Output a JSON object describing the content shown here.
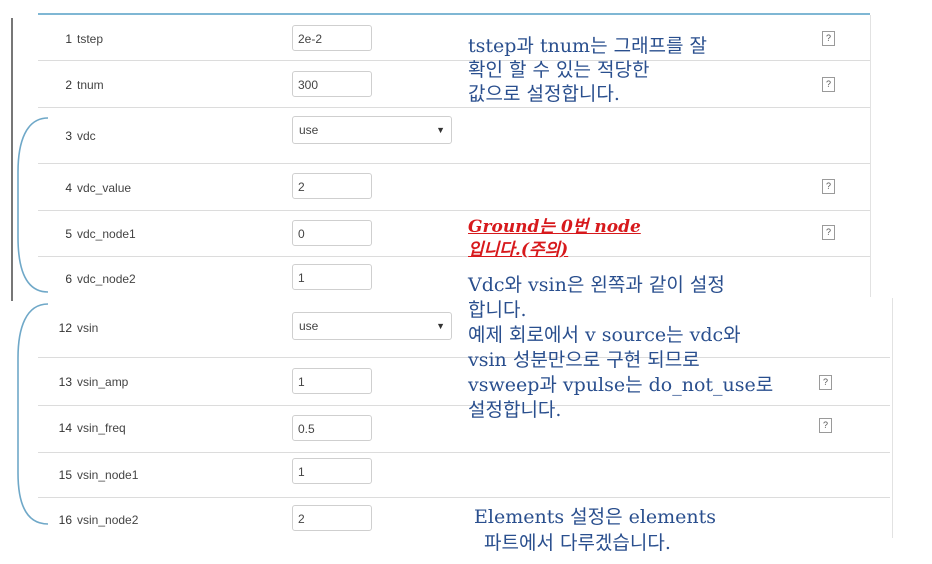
{
  "params": [
    {
      "num": "1",
      "name": "tstep",
      "type": "input",
      "value": "2e-2",
      "help": "?"
    },
    {
      "num": "2",
      "name": "tnum",
      "type": "input",
      "value": "300",
      "help": "?"
    },
    {
      "num": "3",
      "name": "vdc",
      "type": "select",
      "value": "use"
    },
    {
      "num": "4",
      "name": "vdc_value",
      "type": "input",
      "value": "2",
      "help": "?"
    },
    {
      "num": "5",
      "name": "vdc_node1",
      "type": "input",
      "value": "0",
      "help": "?"
    },
    {
      "num": "6",
      "name": "vdc_node2",
      "type": "input",
      "value": "1"
    },
    {
      "num": "12",
      "name": "vsin",
      "type": "select",
      "value": "use"
    },
    {
      "num": "13",
      "name": "vsin_amp",
      "type": "input",
      "value": "1",
      "help": "?"
    },
    {
      "num": "14",
      "name": "vsin_freq",
      "type": "input",
      "value": "0.5",
      "help": "?"
    },
    {
      "num": "15",
      "name": "vsin_node1",
      "type": "input",
      "value": "1"
    },
    {
      "num": "16",
      "name": "vsin_node2",
      "type": "input",
      "value": "2"
    }
  ],
  "annotations": {
    "tstep_note": [
      "tstep과 tnum는 그래프를 잘",
      "확인 할 수 있는 적당한",
      "값으로 설정합니다."
    ],
    "ground_warning": [
      "Ground는 0번 node",
      "입니다.(주의)"
    ],
    "vsource_note": [
      "Vdc와 vsin은 왼쪽과 같이 설정",
      "합니다.",
      "예제 회로에서 v source는 vdc와",
      "vsin 성분만으로 구현 되므로",
      "vsweep과 vpulse는 do_not_use로",
      "설정합니다."
    ],
    "elements_note": [
      "Elements 설정은 elements",
      "파트에서 다루겠습니다."
    ]
  },
  "colors": {
    "annotation": "#2a4f8e",
    "warning": "#d7191c",
    "bracket": "#6fa8c8",
    "accent_line": "#7fb7d4"
  }
}
